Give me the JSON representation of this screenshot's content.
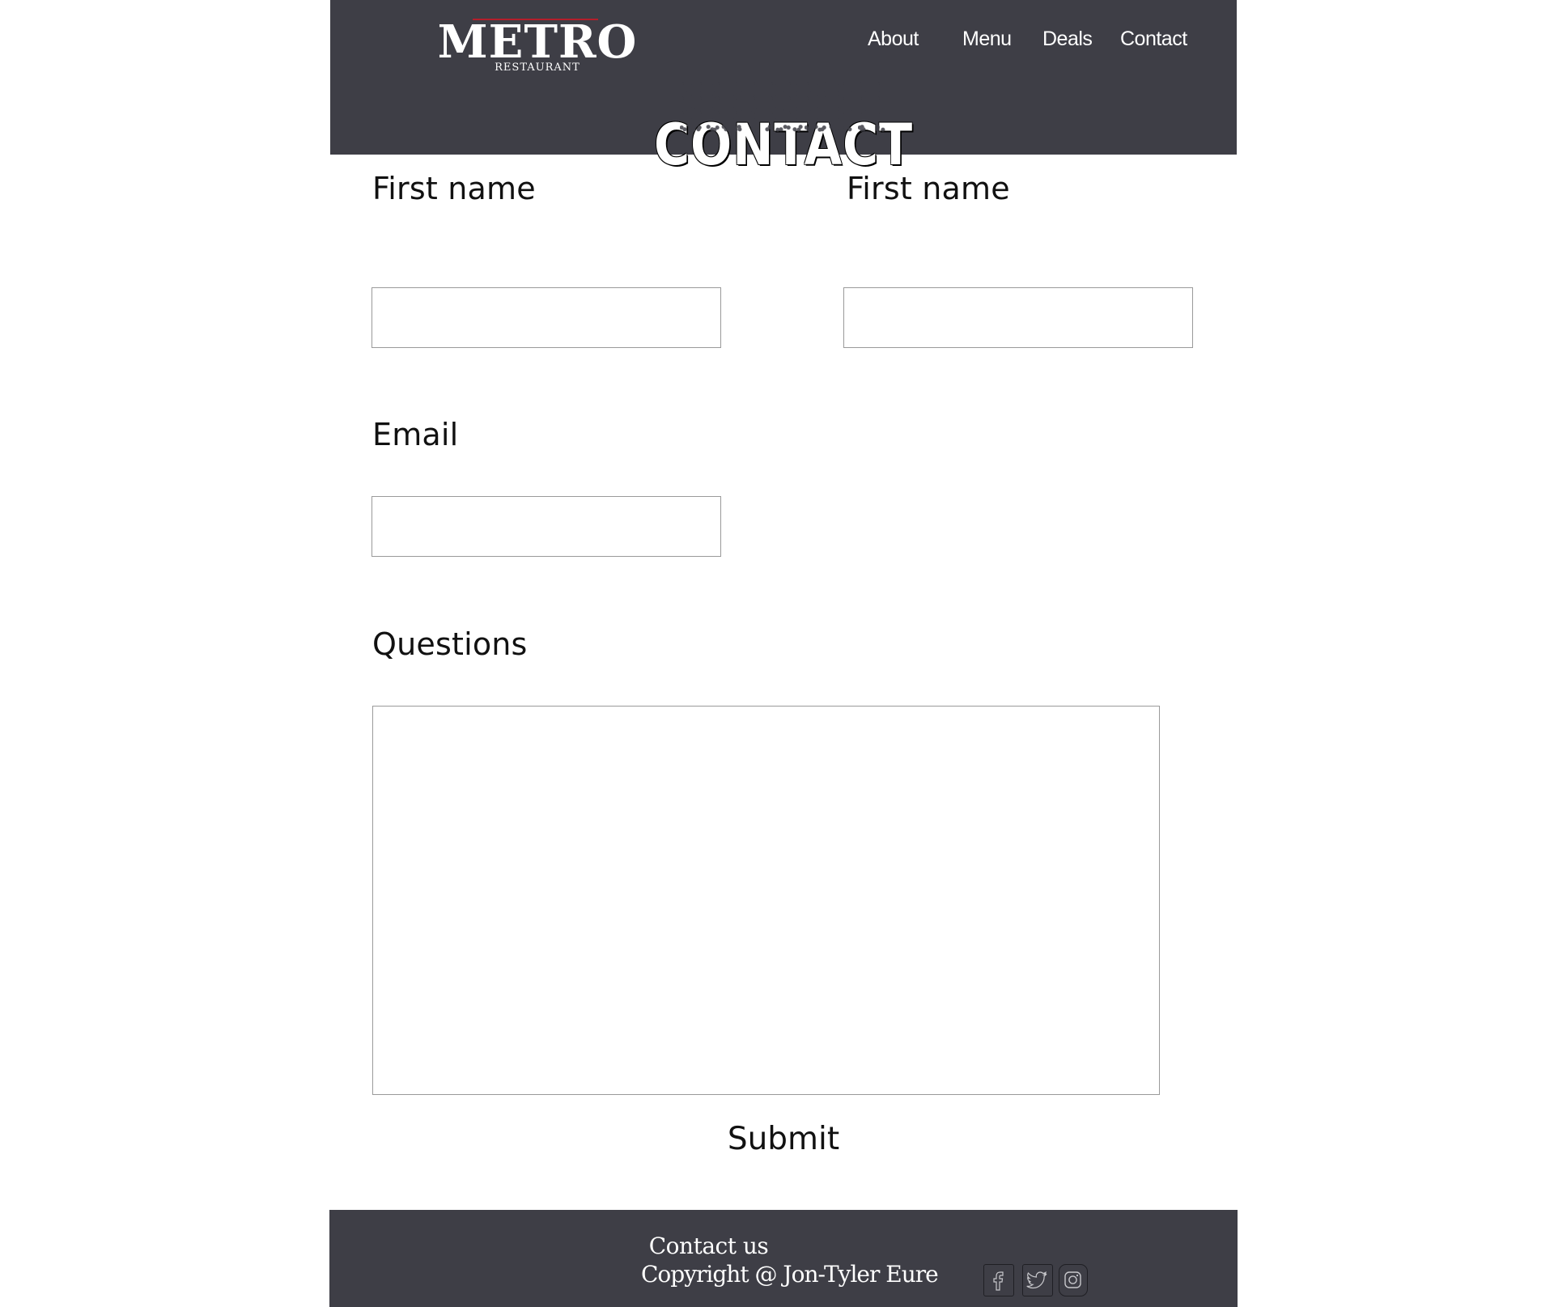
{
  "header": {
    "logo": {
      "name": "METRO",
      "tagline": "RESTAURANT"
    },
    "nav": [
      {
        "label": "About"
      },
      {
        "label": "Menu"
      },
      {
        "label": "Deals"
      },
      {
        "label": "Contact"
      }
    ],
    "page_heading": "CONTACT"
  },
  "form": {
    "first_name_1": {
      "label": "First name",
      "value": "",
      "placeholder": ""
    },
    "first_name_2": {
      "label": "First name",
      "value": "",
      "placeholder": ""
    },
    "email": {
      "label": "Email",
      "value": "",
      "placeholder": ""
    },
    "questions": {
      "label": "Questions",
      "value": "",
      "placeholder": ""
    },
    "submit_label": "Submit"
  },
  "footer": {
    "contact_label": "Contact us",
    "copyright": "Copyright @ Jon-Tyler Eure",
    "social_icons": [
      "facebook-icon",
      "twitter-icon",
      "instagram-icon"
    ]
  },
  "colors": {
    "header_bg": "#3e3e46",
    "footer_bg": "#3e3e46",
    "logo_accent": "#b41e2b",
    "text_on_dark": "#ffffff",
    "input_border": "#9a9a9a"
  }
}
